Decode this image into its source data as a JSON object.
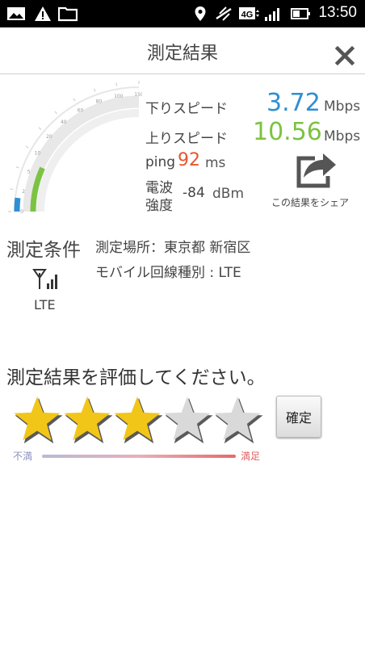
{
  "status_bar": {
    "icons": [
      "image-icon",
      "warning-icon",
      "folder-icon",
      "location-icon",
      "vibrate-icon",
      "network-4g-icon",
      "signal-icon",
      "battery-icon"
    ],
    "network_badge": "4G",
    "time": "13:50"
  },
  "header": {
    "title": "測定結果",
    "close_icon": "close-icon"
  },
  "gauge": {
    "ticks": [
      "0",
      "2",
      "5",
      "10",
      "20",
      "40",
      "60",
      "80",
      "100",
      "150"
    ],
    "download_fill_level": 0.13,
    "upload_fill_level": 0.27,
    "download_color": "#2e8fd3",
    "upload_color": "#7cc243"
  },
  "results": {
    "download": {
      "label": "下りスピード",
      "value": "3.72",
      "unit": "Mbps"
    },
    "upload": {
      "label": "上りスピード",
      "value": "10.56",
      "unit": "Mbps"
    },
    "ping": {
      "label": "ping",
      "value": "92",
      "unit": "ms"
    },
    "signal": {
      "label_line1": "電波",
      "label_line2": "強度",
      "value": "-84",
      "unit": "dBm"
    }
  },
  "share": {
    "icon": "share-icon",
    "label": "この結果をシェア"
  },
  "conditions": {
    "title": "測定条件",
    "location": "測定場所：東京都 新宿区",
    "network_type": "モバイル回線種別 : LTE",
    "network_icon": "antenna-signal-icon",
    "network_label": "LTE"
  },
  "rating": {
    "prompt": "測定結果を評価してください。",
    "max": 5,
    "selected": 3,
    "filled_color": "#f2c619",
    "empty_color": "#d9d9d9",
    "confirm_label": "確定",
    "scale_low": "不満",
    "scale_high": "満足"
  }
}
